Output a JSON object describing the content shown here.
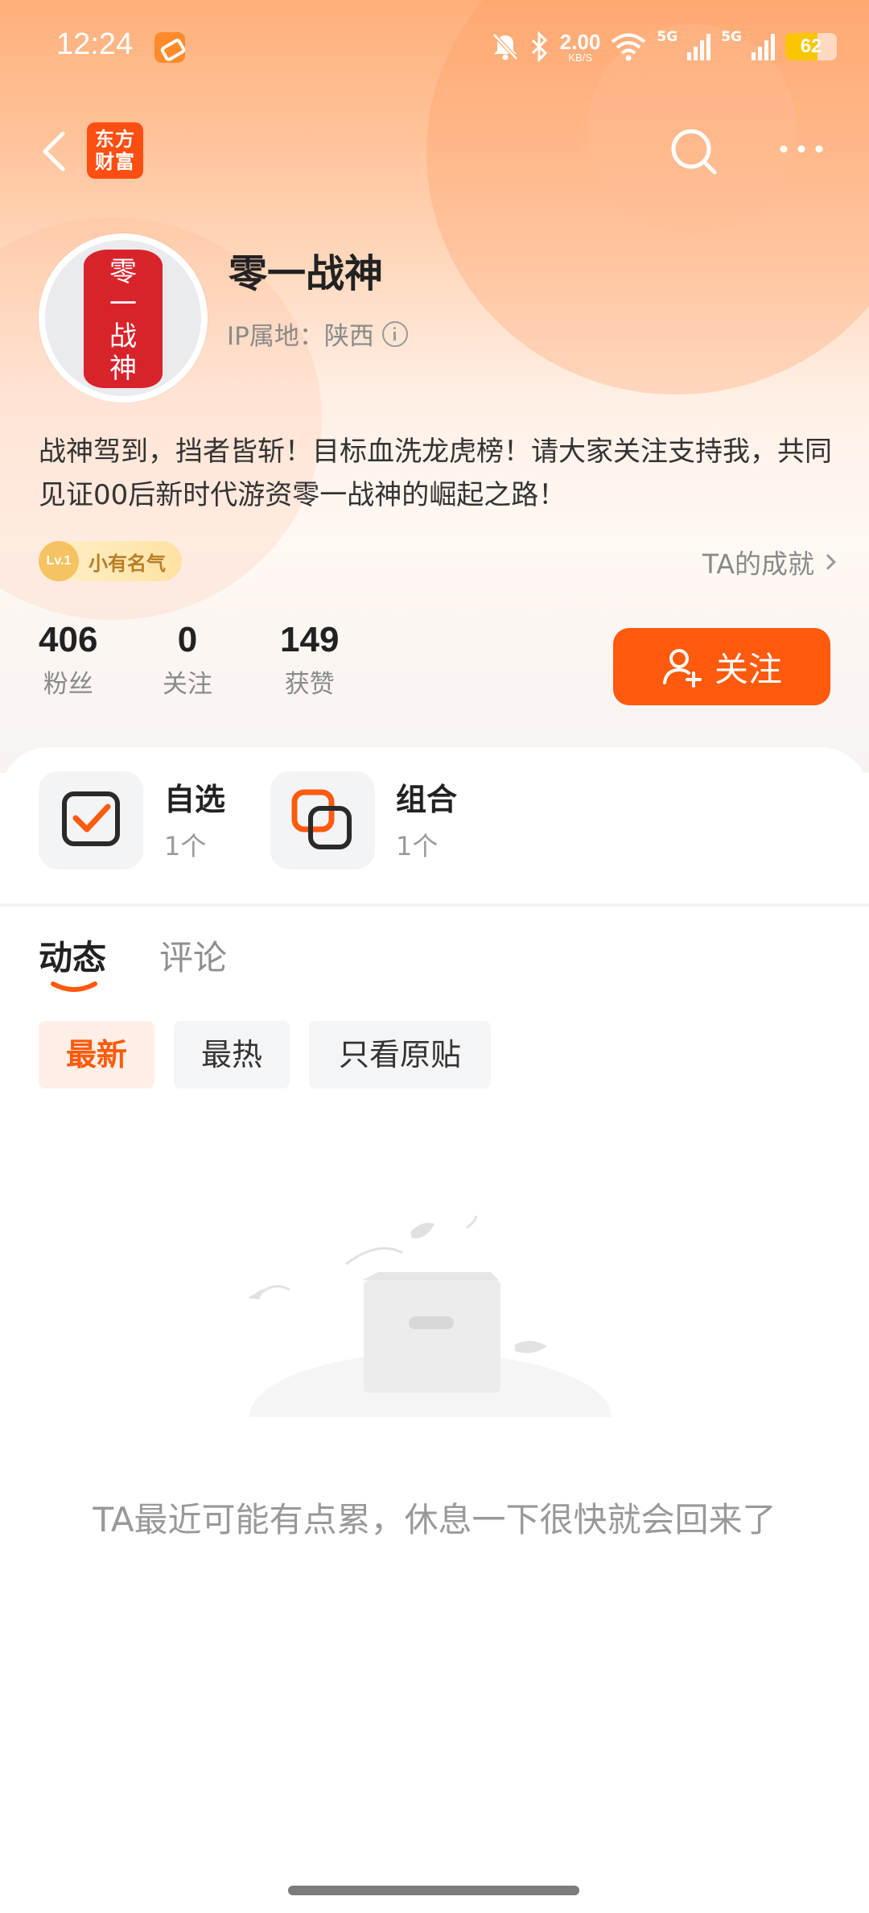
{
  "status_bar": {
    "time": "12:24",
    "net_speed": "2.00",
    "net_unit": "KB/S",
    "signal_1": "5G",
    "signal_2": "5G",
    "battery": "62"
  },
  "nav": {
    "logo_text": "东方财富",
    "back_icon": "back-chevron-icon",
    "search_icon": "search-icon",
    "more_icon": "more-dots-icon"
  },
  "profile": {
    "name": "零一战神",
    "ip_label": "IP属地：陕西",
    "avatar_seal_text": "零一战神",
    "bio": "战神驾到，挡者皆斩！目标血洗龙虎榜！请大家关注支持我，共同见证00后新时代游资零一战神的崛起之路！",
    "badge_level": "Lv.1",
    "badge_label": "小有名气",
    "achievements_link": "TA的成就"
  },
  "stats": [
    {
      "value": "406",
      "label": "粉丝"
    },
    {
      "value": "0",
      "label": "关注"
    },
    {
      "value": "149",
      "label": "获赞"
    }
  ],
  "follow_button": "关注",
  "tiles": [
    {
      "title": "自选",
      "count": "1个"
    },
    {
      "title": "组合",
      "count": "1个"
    }
  ],
  "tabs": [
    {
      "label": "动态",
      "active": true
    },
    {
      "label": "评论",
      "active": false
    }
  ],
  "filters": [
    {
      "label": "最新",
      "selected": true
    },
    {
      "label": "最热",
      "selected": false
    },
    {
      "label": "只看原贴",
      "selected": false
    }
  ],
  "empty_state": {
    "message": "TA最近可能有点累，休息一下很快就会回来了"
  },
  "colors": {
    "accent": "#ff5a0d",
    "brand": "#ff4e12",
    "seal_red": "#d9232b"
  }
}
